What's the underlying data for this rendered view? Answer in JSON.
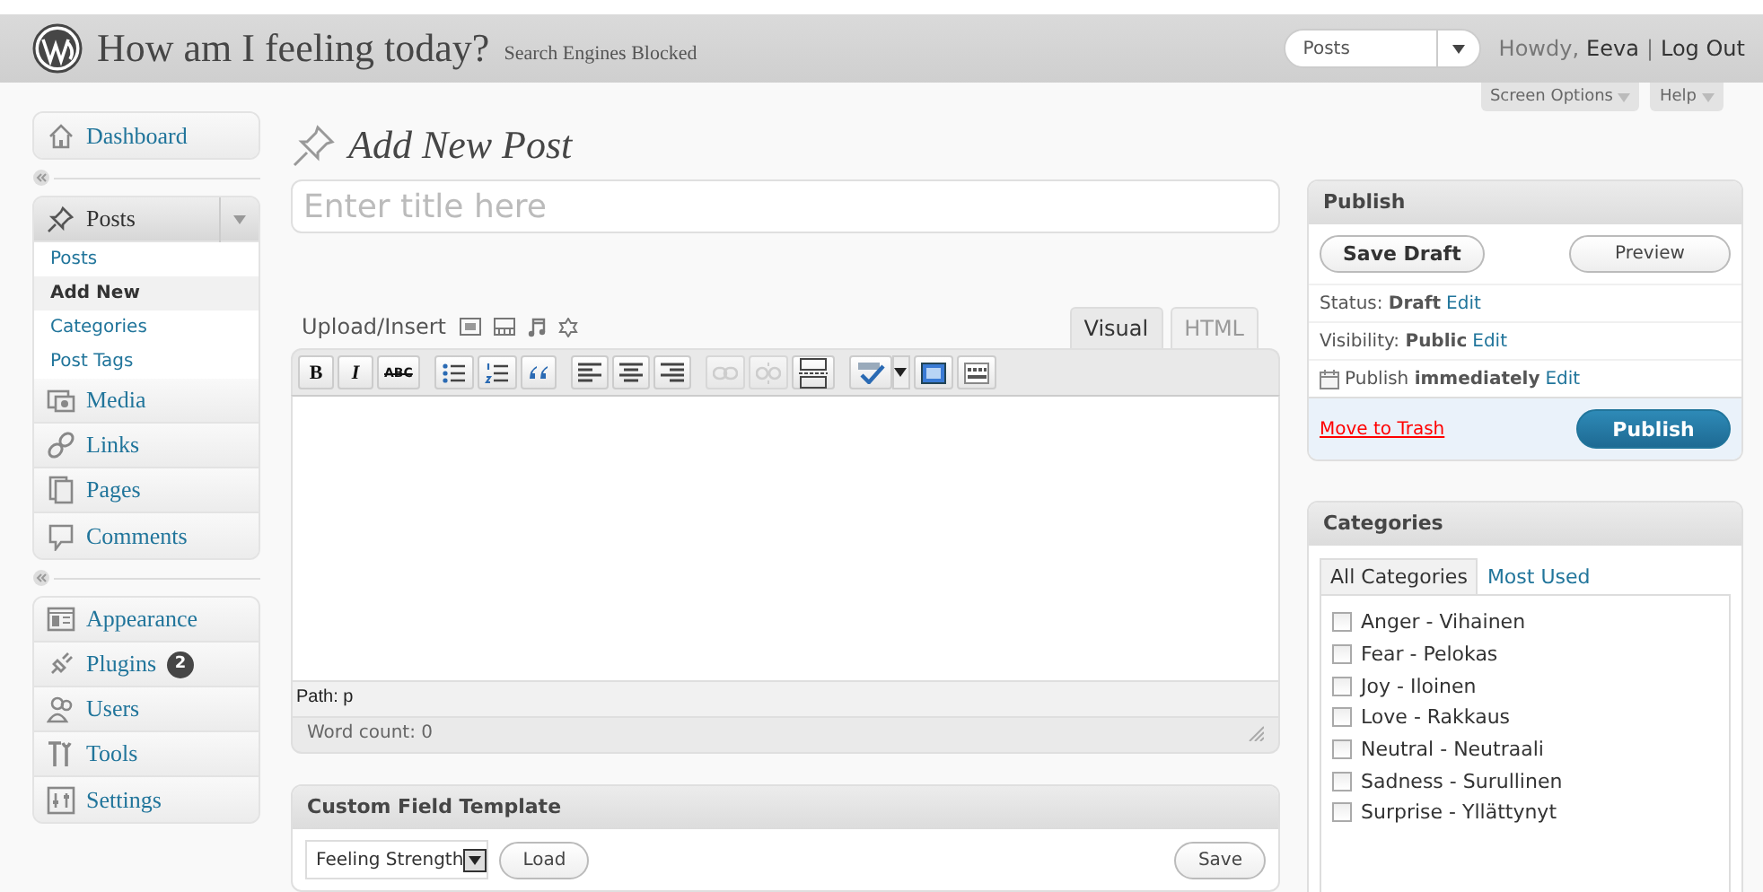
{
  "header": {
    "site_title": "How am I feeling today?",
    "notice": "Search Engines Blocked",
    "favorites": "Posts",
    "greeting": "Howdy,",
    "user": "Eeva",
    "separator": "|",
    "logout": "Log Out"
  },
  "screen_tabs": [
    {
      "label": "Screen Options"
    },
    {
      "label": "Help"
    }
  ],
  "menu": [
    {
      "items": [
        {
          "label": "Dashboard",
          "selected": false,
          "expanded": false
        }
      ]
    },
    {
      "items": [
        {
          "label": "Posts",
          "selected": true,
          "expanded": true,
          "children": [
            {
              "label": "Posts",
              "selected": false
            },
            {
              "label": "Add New",
              "selected": true
            },
            {
              "label": "Categories",
              "selected": false
            },
            {
              "label": "Post Tags",
              "selected": false
            }
          ]
        },
        {
          "label": "Media",
          "selected": false,
          "expanded": false
        },
        {
          "label": "Links",
          "selected": false,
          "expanded": false
        },
        {
          "label": "Pages",
          "selected": false,
          "expanded": false
        },
        {
          "label": "Comments",
          "selected": false,
          "expanded": false
        }
      ]
    },
    {
      "items": [
        {
          "label": "Appearance",
          "selected": false,
          "expanded": false
        },
        {
          "label": "Plugins",
          "selected": false,
          "expanded": false,
          "badge": "2"
        },
        {
          "label": "Users",
          "selected": false,
          "expanded": false
        },
        {
          "label": "Tools",
          "selected": false,
          "expanded": false
        },
        {
          "label": "Settings",
          "selected": false,
          "expanded": false
        }
      ]
    }
  ],
  "page_title": "Add New Post",
  "title_field": {
    "placeholder": "Enter title here"
  },
  "editor": {
    "upload_label": "Upload/Insert",
    "tabs": [
      {
        "label": "Visual",
        "selected": true
      },
      {
        "label": "HTML",
        "selected": false
      }
    ],
    "toolbar": [
      {
        "kind": "bold",
        "label": "B",
        "disabled": false
      },
      {
        "kind": "italic",
        "label": "I",
        "disabled": false
      },
      {
        "kind": "strikethrough",
        "label": "ABC",
        "disabled": false
      },
      {
        "kind": "bullets",
        "disabled": false
      },
      {
        "kind": "numbers",
        "disabled": false
      },
      {
        "kind": "quote",
        "disabled": false
      },
      {
        "kind": "align-left",
        "disabled": false
      },
      {
        "kind": "align-center",
        "disabled": false
      },
      {
        "kind": "align-right",
        "disabled": false
      },
      {
        "kind": "link",
        "disabled": true
      },
      {
        "kind": "unlink",
        "disabled": true
      },
      {
        "kind": "more",
        "disabled": false
      },
      {
        "kind": "spellcheck",
        "disabled": false
      },
      {
        "kind": "fullscreen",
        "disabled": false
      },
      {
        "kind": "kitchen-sink",
        "disabled": false
      }
    ],
    "path": "Path: p",
    "word_count": "Word count: 0"
  },
  "custom_field_template": {
    "title": "Custom Field Template",
    "template": "Feeling Strength",
    "load": "Load",
    "save": "Save"
  },
  "publish": {
    "title": "Publish",
    "save_draft": "Save Draft",
    "preview": "Preview",
    "rows": [
      {
        "kind": "status",
        "text": "Status: **Draft**",
        "link": "Edit"
      },
      {
        "kind": "visibility",
        "text": "Visibility: **Public**",
        "link": "Edit"
      },
      {
        "kind": "schedule",
        "text": "Publish **immediately**",
        "link": "Edit"
      }
    ],
    "trash": "Move to Trash",
    "publish": "Publish"
  },
  "categories": {
    "title": "Categories",
    "tabs": [
      {
        "label": "All Categories",
        "selected": true
      },
      {
        "label": "Most Used",
        "selected": false
      }
    ],
    "items": [
      {
        "label": "Anger - Vihainen",
        "checked": false
      },
      {
        "label": "Fear - Pelokas",
        "checked": false
      },
      {
        "label": "Joy - Iloinen",
        "checked": false
      },
      {
        "label": "Love - Rakkaus",
        "checked": false
      },
      {
        "label": "Neutral - Neutraali",
        "checked": false
      },
      {
        "label": "Sadness - Surullinen",
        "checked": false
      },
      {
        "label": "Surprise - Yllättynyt",
        "checked": false
      }
    ]
  }
}
